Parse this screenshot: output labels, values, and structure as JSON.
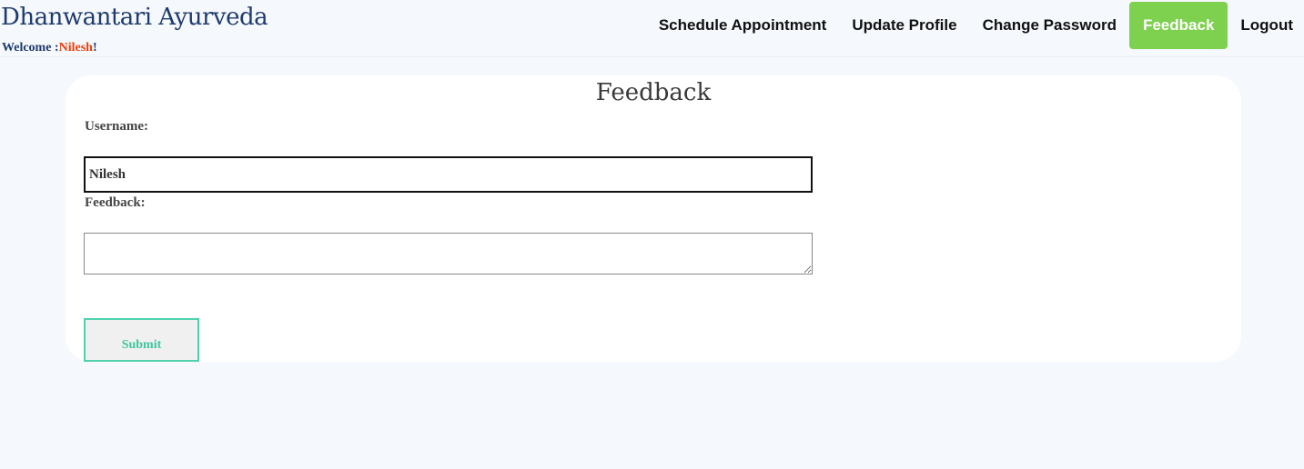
{
  "header": {
    "brand": "Dhanwantari Ayurveda",
    "welcome_prefix": "Welcome :",
    "welcome_user": "Nilesh",
    "welcome_suffix": "!"
  },
  "nav": {
    "items": [
      {
        "label": "Schedule Appointment"
      },
      {
        "label": "Update Profile"
      },
      {
        "label": "Change Password"
      },
      {
        "label": "Feedback",
        "active": true
      },
      {
        "label": "Logout"
      }
    ],
    "active_color": "#7ed04f"
  },
  "form": {
    "title": "Feedback",
    "username_label": "Username:",
    "username_value": "Nilesh",
    "feedback_label": "Feedback:",
    "feedback_value": "",
    "submit_label": "Submit"
  },
  "colors": {
    "brand": "#1f3b6e",
    "welcome_user": "#e8410f",
    "submit_border": "#4fd1ad",
    "page_bg": "#f5f8fc"
  }
}
